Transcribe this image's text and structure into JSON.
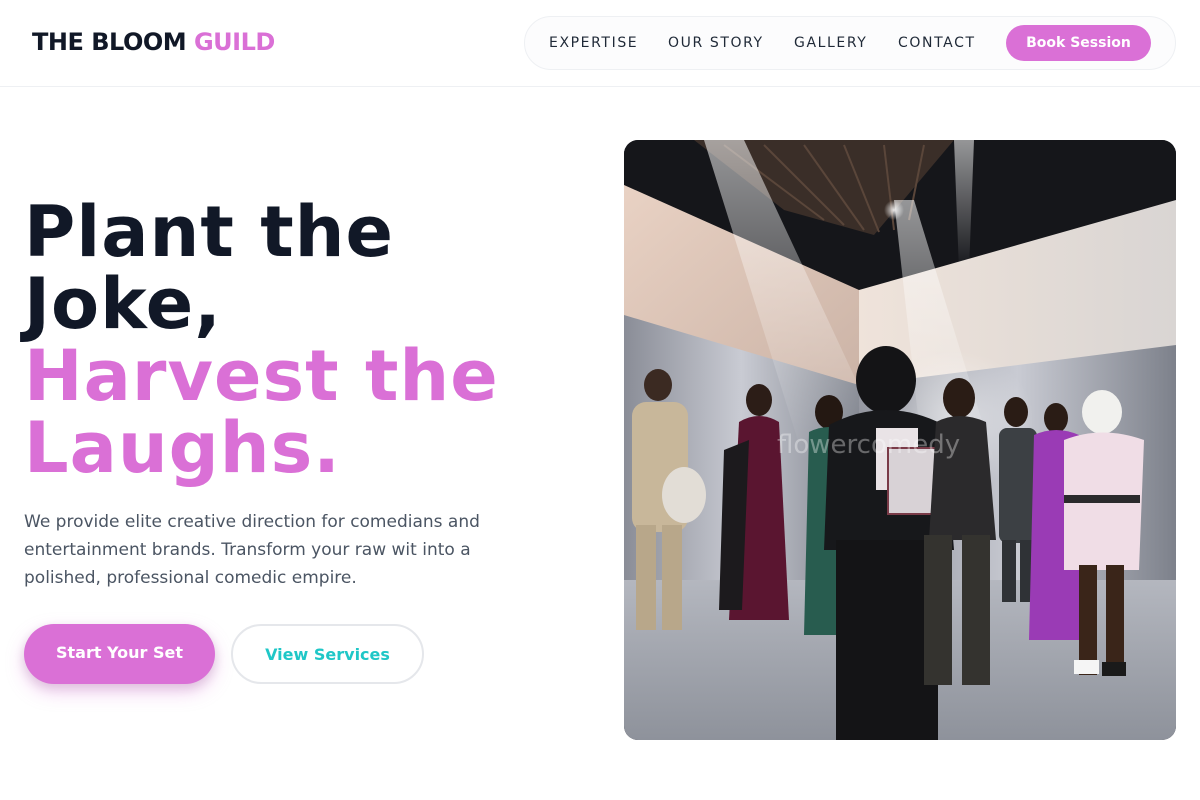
{
  "brand": {
    "name_main": "THE BLOOM",
    "name_accent": "GUILD"
  },
  "nav": {
    "items": [
      {
        "label": "EXPERTISE"
      },
      {
        "label": "OUR STORY"
      },
      {
        "label": "GALLERY"
      },
      {
        "label": "CONTACT"
      }
    ],
    "cta_label": "Book Session"
  },
  "hero": {
    "headline_line1": "Plant the",
    "headline_line2": "Joke,",
    "headline_line3": "Harvest the",
    "headline_line4": "Laughs.",
    "subtext": "We provide elite creative direction for comedians and entertainment brands. Transform your raw wit into a polished, professional comedic empire.",
    "primary_cta": "Start Your Set",
    "secondary_cta": "View Services",
    "image_watermark": "flowercomedy"
  },
  "colors": {
    "accent": "#da70d6",
    "secondary_text": "#1fc7c7",
    "heading": "#111827",
    "body_text": "#4b5563"
  }
}
